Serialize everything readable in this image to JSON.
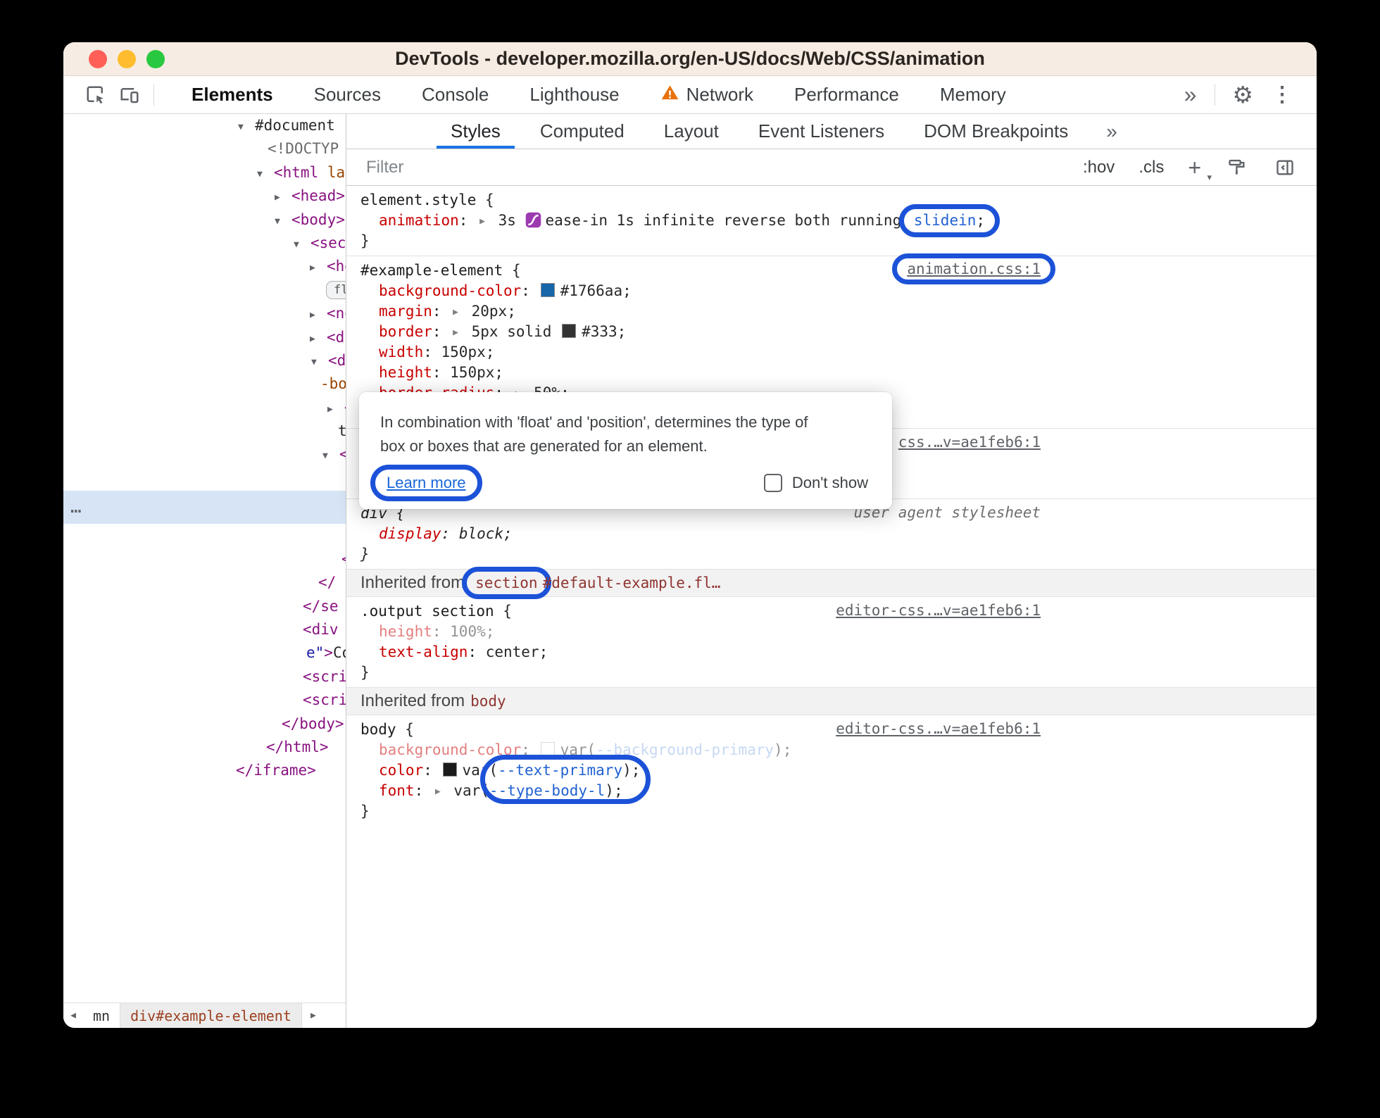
{
  "window": {
    "title": "DevTools - developer.mozilla.org/en-US/docs/Web/CSS/animation",
    "traffic_lights": [
      "#ff5f57",
      "#febc2e",
      "#28c840"
    ]
  },
  "icons": {
    "toggle_open": "▼",
    "toggle_closed": "▶",
    "expand_arrow": "▶",
    "chevrons": "»",
    "gear": "⚙",
    "kebab": "⋮",
    "scroll_left": "◀",
    "scroll_right": "▶",
    "caret": "▾"
  },
  "colors": {
    "annotation_blue": "#1c52d8",
    "warning_orange": "#e8710a",
    "swatch_blue": "#1766aa",
    "swatch_dark": "#333333",
    "accent_tab_underline": "#1a73e8"
  },
  "toolbar": {
    "tabs": [
      {
        "label": "Elements",
        "active": true
      },
      {
        "label": "Sources"
      },
      {
        "label": "Console"
      },
      {
        "label": "Lighthouse"
      },
      {
        "label": "Network",
        "warning": true
      },
      {
        "label": "Performance"
      },
      {
        "label": "Memory"
      }
    ]
  },
  "styles_tabs": {
    "tabs": [
      {
        "label": "Styles",
        "active": true
      },
      {
        "label": "Computed"
      },
      {
        "label": "Layout"
      },
      {
        "label": "Event Listeners"
      },
      {
        "label": "DOM Breakpoints"
      }
    ]
  },
  "filter_bar": {
    "placeholder": "Filter",
    "hov": ":hov",
    "cls": ".cls",
    "new_rule": "+"
  },
  "breadcrumbs": {
    "prev": "mn",
    "current": "div#example-element"
  },
  "tooltip": {
    "line1": "In combination with 'float' and 'position', determines the type of",
    "line2": "box or boxes that are generated for an element.",
    "learn_more": "Learn more",
    "dont_show": "Don't show"
  },
  "dom_tree": {
    "rows": [
      {
        "ind": 248,
        "tok": [
          {
            "k": "tog",
            "open": true
          },
          {
            "t": "#document",
            "c": "pl"
          }
        ]
      },
      {
        "ind": 290,
        "tok": [
          {
            "t": "<!DOCTYP",
            "c": "doc"
          }
        ]
      },
      {
        "ind": 275,
        "tok": [
          {
            "k": "tog",
            "open": true
          },
          {
            "t": "<html ",
            "c": "tag"
          },
          {
            "t": "la",
            "c": "attr"
          }
        ]
      },
      {
        "ind": 300,
        "tok": [
          {
            "k": "tog"
          },
          {
            "t": "<head>",
            "c": "tag"
          }
        ]
      },
      {
        "ind": 300,
        "tok": [
          {
            "k": "tog",
            "open": true
          },
          {
            "t": "<body>",
            "c": "tag"
          }
        ]
      },
      {
        "ind": 327,
        "tok": [
          {
            "k": "tog",
            "open": true
          },
          {
            "t": "<sect",
            "c": "tag"
          }
        ]
      },
      {
        "ind": 350,
        "tok": [
          {
            "k": "tog"
          },
          {
            "t": "<he",
            "c": "tag"
          }
        ]
      },
      {
        "ind": 373,
        "tok": [
          {
            "k": "badge",
            "t": "fl"
          }
        ]
      },
      {
        "ind": 350,
        "tok": [
          {
            "k": "tog"
          },
          {
            "t": "<no",
            "c": "tag"
          }
        ]
      },
      {
        "ind": 350,
        "tok": [
          {
            "k": "tog"
          },
          {
            "t": "<di",
            "c": "tag"
          }
        ]
      },
      {
        "ind": 352,
        "tok": [
          {
            "k": "tog",
            "open": true
          },
          {
            "t": "<di",
            "c": "tag"
          }
        ]
      },
      {
        "ind": 365,
        "tok": [
          {
            "t": "-bo",
            "c": "attr"
          }
        ]
      },
      {
        "ind": 375,
        "tok": [
          {
            "k": "tog"
          },
          {
            "t": "<",
            "c": "tag"
          }
        ]
      },
      {
        "ind": 390,
        "tok": [
          {
            "t": "t",
            "c": "pl"
          }
        ]
      },
      {
        "ind": 368,
        "tok": [
          {
            "k": "tog",
            "open": true
          },
          {
            "t": "<",
            "c": "tag"
          }
        ]
      },
      {
        "spacer": true
      },
      {
        "selected": true,
        "tok": [
          {
            "t": "…",
            "c": "dots"
          }
        ]
      },
      {
        "spacer": true
      },
      {
        "ind": 395,
        "tok": [
          {
            "t": "<",
            "c": "tag"
          }
        ]
      },
      {
        "ind": 362,
        "tok": [
          {
            "t": "</",
            "c": "tag"
          }
        ]
      },
      {
        "ind": 340,
        "tok": [
          {
            "t": "</se",
            "c": "tag"
          }
        ]
      },
      {
        "ind": 340,
        "tok": [
          {
            "t": "<div",
            "c": "tag"
          }
        ]
      },
      {
        "ind": 345,
        "tok": [
          {
            "t": "e\"",
            "c": "str"
          },
          {
            "t": ">",
            "c": "tag"
          },
          {
            "t": "Co",
            "c": "pl"
          }
        ]
      },
      {
        "ind": 340,
        "tok": [
          {
            "t": "<scri",
            "c": "tag"
          }
        ]
      },
      {
        "ind": 340,
        "tok": [
          {
            "t": "<scri",
            "c": "tag"
          }
        ]
      },
      {
        "ind": 310,
        "tok": [
          {
            "t": "</body>",
            "c": "tag"
          }
        ]
      },
      {
        "ind": 288,
        "tok": [
          {
            "t": "</html>",
            "c": "tag"
          }
        ]
      },
      {
        "ind": 245,
        "tok": [
          {
            "t": "</iframe>",
            "c": "tag"
          }
        ]
      }
    ]
  },
  "styles_pane": {
    "sections": [
      {
        "type": "rule",
        "name": "element-style",
        "lines": [
          {
            "ind": 0,
            "tok": [
              {
                "t": "element.style",
                "c": "sel"
              },
              {
                "t": " {",
                "c": "pl"
              }
            ]
          },
          {
            "ind": 1,
            "tok": [
              {
                "t": "animation",
                "c": "prop"
              },
              {
                "t": ": ",
                "c": "pl"
              },
              {
                "k": "arrow"
              },
              {
                "t": " 3s ",
                "c": "pl"
              },
              {
                "k": "bezier"
              },
              {
                "t": "ease-in 1s infinite reverse both running ",
                "c": "pl"
              },
              {
                "k": "annot",
                "tok": [
                  {
                    "t": "slidein",
                    "c": "blue"
                  },
                  {
                    "t": ";",
                    "c": "pl"
                  }
                ]
              }
            ]
          },
          {
            "ind": 0,
            "tok": [
              {
                "t": "}",
                "c": "pl"
              }
            ]
          }
        ]
      },
      {
        "type": "rule",
        "name": "example-element",
        "link": {
          "text": "animation.css:1",
          "annot": true
        },
        "lines": [
          {
            "ind": 0,
            "tok": [
              {
                "t": "#example-element",
                "c": "sel"
              },
              {
                "t": " {",
                "c": "pl"
              }
            ]
          },
          {
            "ind": 1,
            "tok": [
              {
                "t": "background-color",
                "c": "prop"
              },
              {
                "t": ": ",
                "c": "pl"
              },
              {
                "k": "swatch",
                "color": "#1766aa"
              },
              {
                "t": "#1766aa;",
                "c": "pl"
              }
            ]
          },
          {
            "ind": 1,
            "tok": [
              {
                "t": "margin",
                "c": "prop"
              },
              {
                "t": ": ",
                "c": "pl"
              },
              {
                "k": "arrow"
              },
              {
                "t": " 20px;",
                "c": "pl"
              }
            ]
          },
          {
            "ind": 1,
            "tok": [
              {
                "t": "border",
                "c": "prop"
              },
              {
                "t": ": ",
                "c": "pl"
              },
              {
                "k": "arrow"
              },
              {
                "t": " 5px solid ",
                "c": "pl"
              },
              {
                "k": "swatch",
                "color": "#333333"
              },
              {
                "t": "#333;",
                "c": "pl"
              }
            ]
          },
          {
            "ind": 1,
            "tok": [
              {
                "t": "width",
                "c": "prop"
              },
              {
                "t": ": ",
                "c": "pl"
              },
              {
                "t": "150px;",
                "c": "pl"
              }
            ]
          },
          {
            "ind": 1,
            "tok": [
              {
                "t": "height",
                "c": "prop"
              },
              {
                "t": ": ",
                "c": "pl"
              },
              {
                "t": "150px;",
                "c": "pl"
              }
            ]
          },
          {
            "ind": 1,
            "tok": [
              {
                "t": "border-radius",
                "c": "prop"
              },
              {
                "t": ": ",
                "c": "pl"
              },
              {
                "k": "arrow"
              },
              {
                "t": " 50%;",
                "c": "pl"
              }
            ]
          },
          {
            "ind": 0,
            "tok": [
              {
                "t": "}",
                "c": "pl"
              }
            ]
          }
        ]
      },
      {
        "type": "rule",
        "name": "universal",
        "link": {
          "text": "css.…v=ae1feb6:1"
        },
        "lines": [
          {
            "ind": 0,
            "tok": [
              {
                "t": "* {",
                "c": "pl"
              }
            ]
          },
          {
            "ind": 1,
            "tok": []
          },
          {
            "ind": 0,
            "tok": [
              {
                "t": "}",
                "c": "pl"
              }
            ]
          }
        ]
      },
      {
        "type": "rule",
        "name": "div-user-agent",
        "italic": true,
        "link": {
          "text": "user agent stylesheet",
          "ua": true
        },
        "lines": [
          {
            "ind": 0,
            "tok": [
              {
                "t": "div",
                "c": "sel"
              },
              {
                "t": " {",
                "c": "pl"
              }
            ]
          },
          {
            "ind": 1,
            "tok": [
              {
                "t": "display",
                "c": "prop"
              },
              {
                "t": ": ",
                "c": "pl"
              },
              {
                "t": "block;",
                "c": "pl"
              }
            ]
          },
          {
            "ind": 0,
            "tok": [
              {
                "t": "}",
                "c": "pl"
              }
            ]
          }
        ]
      },
      {
        "type": "header",
        "name": "inherited-from-section",
        "tok": [
          {
            "t": "Inherited from",
            "c": "hdr"
          },
          {
            "k": "annot",
            "tok": [
              {
                "t": "section",
                "c": "node"
              }
            ]
          },
          {
            "t": "#default-example.fl…",
            "c": "node"
          }
        ]
      },
      {
        "type": "rule",
        "name": "output-section",
        "link": {
          "text": "editor-css.…v=ae1feb6:1"
        },
        "lines": [
          {
            "ind": 0,
            "tok": [
              {
                "t": ".output section",
                "c": "sel"
              },
              {
                "t": " {",
                "c": "pl"
              }
            ]
          },
          {
            "ind": 1,
            "dim": true,
            "tok": [
              {
                "t": "height",
                "c": "prop"
              },
              {
                "t": ": ",
                "c": "pl"
              },
              {
                "t": "100%;",
                "c": "pl"
              }
            ]
          },
          {
            "ind": 1,
            "tok": [
              {
                "t": "text-align",
                "c": "prop"
              },
              {
                "t": ": ",
                "c": "pl"
              },
              {
                "t": "center;",
                "c": "pl"
              }
            ]
          },
          {
            "ind": 0,
            "tok": [
              {
                "t": "}",
                "c": "pl"
              }
            ]
          }
        ]
      },
      {
        "type": "header",
        "name": "inherited-from-body",
        "tok": [
          {
            "t": "Inherited from",
            "c": "hdr"
          },
          {
            "t": "body",
            "c": "node"
          }
        ]
      },
      {
        "type": "rule",
        "name": "body",
        "var_annot": true,
        "link": {
          "text": "editor-css.…v=ae1feb6:1"
        },
        "lines": [
          {
            "ind": 0,
            "tok": [
              {
                "t": "body",
                "c": "sel"
              },
              {
                "t": " {",
                "c": "pl"
              }
            ]
          },
          {
            "ind": 1,
            "dim": true,
            "tok": [
              {
                "t": "background-color",
                "c": "prop"
              },
              {
                "t": ": ",
                "c": "pl"
              },
              {
                "k": "swatch",
                "color": "#ffffff",
                "light": true
              },
              {
                "t": "var(",
                "c": "pl"
              },
              {
                "t": "--background-primary",
                "c": "lblue"
              },
              {
                "t": ");",
                "c": "pl"
              }
            ]
          },
          {
            "ind": 1,
            "tok": [
              {
                "t": "color",
                "c": "prop"
              },
              {
                "t": ": ",
                "c": "pl"
              },
              {
                "k": "swatch",
                "color": "#1b1b1b"
              },
              {
                "t": "var(",
                "c": "pl"
              },
              {
                "t": "--text-primary",
                "c": "blue"
              },
              {
                "t": ");",
                "c": "pl"
              }
            ]
          },
          {
            "ind": 1,
            "tok": [
              {
                "t": "font",
                "c": "prop"
              },
              {
                "t": ": ",
                "c": "pl"
              },
              {
                "k": "arrow"
              },
              {
                "t": " var(",
                "c": "pl"
              },
              {
                "t": "--type-body-l",
                "c": "blue"
              },
              {
                "t": ");",
                "c": "pl"
              }
            ]
          },
          {
            "ind": 0,
            "tok": [
              {
                "t": "}",
                "c": "pl"
              }
            ]
          }
        ]
      }
    ]
  }
}
